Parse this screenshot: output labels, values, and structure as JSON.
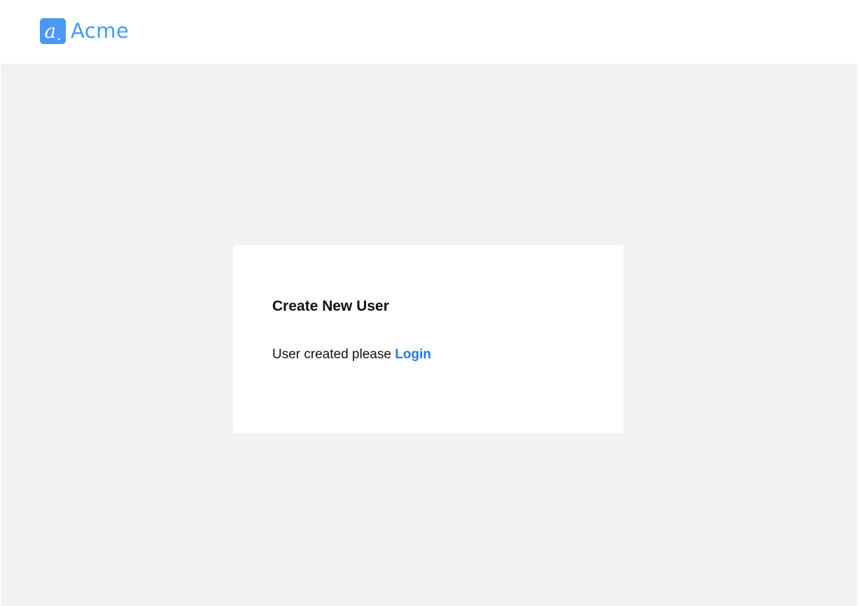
{
  "brand": {
    "icon_glyph": "a",
    "icon_dot": ".",
    "name": "Acme",
    "color": "#4a97f5",
    "icon": "letter-a-logo-icon"
  },
  "card": {
    "title": "Create New User",
    "message": "User created please",
    "link_label": "Login",
    "link_color": "#1f7be6"
  }
}
